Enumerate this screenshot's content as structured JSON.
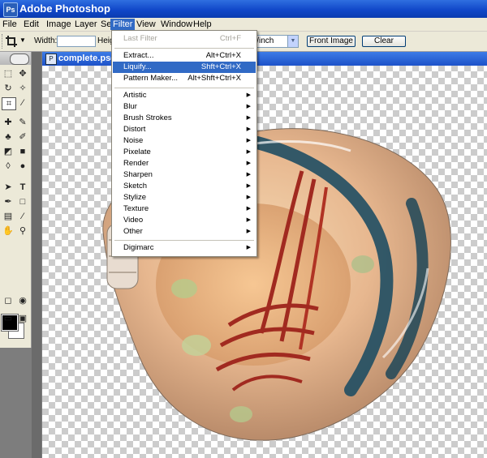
{
  "window": {
    "title": "Adobe Photoshop",
    "app_icon": "Ps"
  },
  "menubar": [
    {
      "label": "File"
    },
    {
      "label": "Edit"
    },
    {
      "label": "Image"
    },
    {
      "label": "Layer"
    },
    {
      "label": "Select"
    },
    {
      "label": "Filter",
      "active": true
    },
    {
      "label": "View"
    },
    {
      "label": "Window"
    },
    {
      "label": "Help"
    }
  ],
  "options": {
    "width_label": "Width:",
    "width_value": "",
    "height_label_partial": "Heig",
    "resolution_unit": "ls/inch",
    "front_image_button": "Front Image",
    "clear_button": "Clear"
  },
  "document": {
    "title": "complete.psd"
  },
  "filter_menu": {
    "items": [
      {
        "label": "Last Filter",
        "shortcut": "Ctrl+F",
        "disabled": true
      },
      {
        "label": "Extract...",
        "shortcut": "Alt+Ctrl+X"
      },
      {
        "label": "Liquify...",
        "shortcut": "Shft+Ctrl+X",
        "highlighted": true
      },
      {
        "label": "Pattern Maker...",
        "shortcut": "Alt+Shft+Ctrl+X"
      },
      {
        "label": "Artistic",
        "submenu": true
      },
      {
        "label": "Blur",
        "submenu": true
      },
      {
        "label": "Brush Strokes",
        "submenu": true
      },
      {
        "label": "Distort",
        "submenu": true
      },
      {
        "label": "Noise",
        "submenu": true
      },
      {
        "label": "Pixelate",
        "submenu": true
      },
      {
        "label": "Render",
        "submenu": true
      },
      {
        "label": "Sharpen",
        "submenu": true
      },
      {
        "label": "Sketch",
        "submenu": true
      },
      {
        "label": "Stylize",
        "submenu": true
      },
      {
        "label": "Texture",
        "submenu": true
      },
      {
        "label": "Video",
        "submenu": true
      },
      {
        "label": "Other",
        "submenu": true
      },
      {
        "label": "Digimarc",
        "submenu": true
      }
    ],
    "submenu_arrow": "▶"
  },
  "colors": {
    "menu_highlight": "#316ac5",
    "foreground_color": "#000000",
    "background_color": "#ffffff"
  }
}
